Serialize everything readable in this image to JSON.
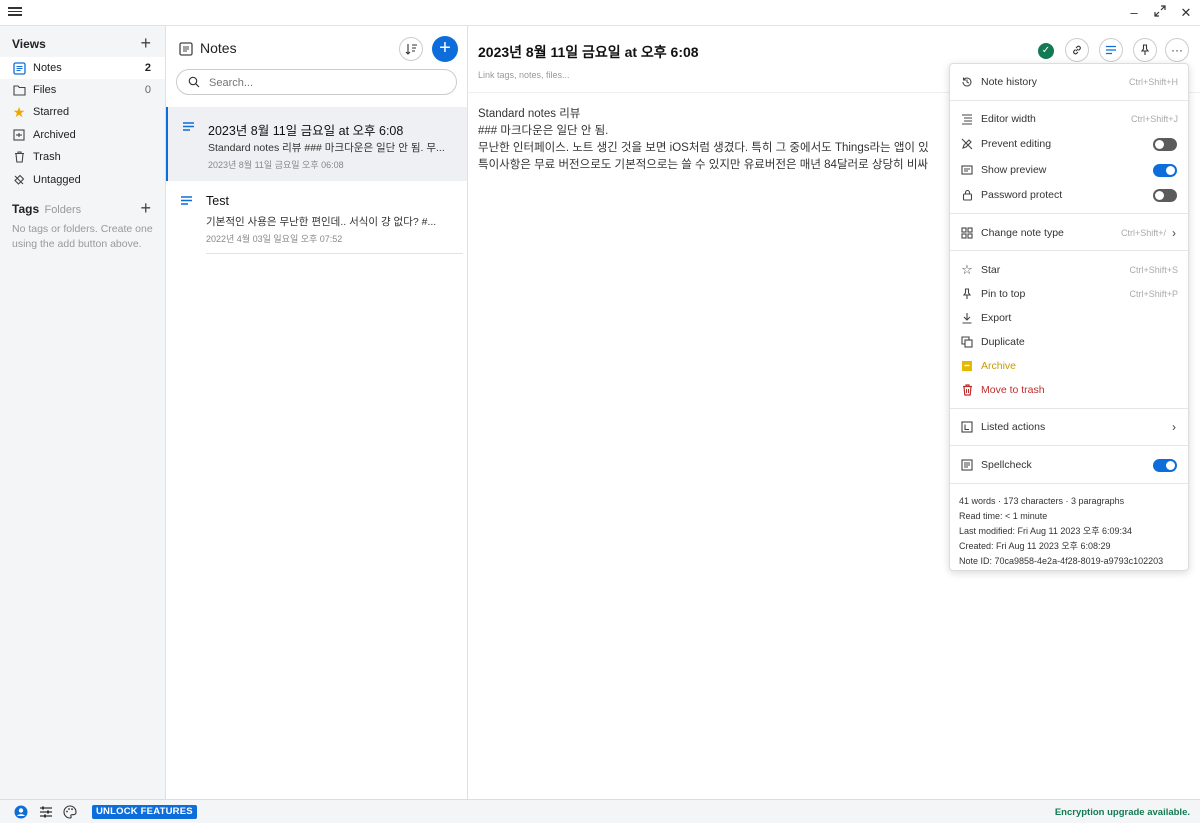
{
  "app": {
    "colors": {
      "accent": "#0c6ddb",
      "success": "#137a53",
      "archive": "#c79a00",
      "trash": "#c02c2c"
    }
  },
  "nav": {
    "views_header": "Views",
    "items": [
      {
        "label": "Notes",
        "count": "2",
        "icon": "notes-icon"
      },
      {
        "label": "Files",
        "count": "0",
        "icon": "folder-icon"
      },
      {
        "label": "Starred",
        "count": "",
        "icon": "star-icon"
      },
      {
        "label": "Archived",
        "count": "",
        "icon": "archive-icon"
      },
      {
        "label": "Trash",
        "count": "",
        "icon": "trash-icon"
      },
      {
        "label": "Untagged",
        "count": "",
        "icon": "untagged-icon"
      }
    ],
    "tags_header": "Tags",
    "tags_sub": "Folders",
    "tags_empty": "No tags or folders. Create one using the add button above."
  },
  "list": {
    "title": "Notes",
    "search_placeholder": "Search...",
    "notes": [
      {
        "title": "2023년 8월 11일 금요일 at 오후 6:08",
        "preview": "Standard notes 리뷰 ### 마크다운은 일단 안 됨. 무...",
        "date": "2023년 8월 11일 금요일 오후 06:08"
      },
      {
        "title": "Test",
        "preview": "기본적인 사용은 무난한 편인데.. 서식이 걍 없다? #...",
        "date": "2022년 4월 03일 일요일 오후 07:52"
      }
    ]
  },
  "editor": {
    "title": "2023년 8월 11일 금요일 at 오후 6:08",
    "tags_placeholder": "Link tags, notes, files...",
    "body": [
      "Standard notes 리뷰",
      "### 마크다운은 일단 안 됨.",
      "무난한 인터페이스. 노트 생긴 것을 보면 iOS처럼 생겼다. 특히 그 중에서도 Things라는 앱이 있",
      "특이사항은 무료 버전으로도 기본적으로는 쓸 수 있지만 유료버전은 매년 84달러로 상당히 비싸"
    ]
  },
  "menu": {
    "note_history": {
      "label": "Note history",
      "shortcut": "Ctrl+Shift+H"
    },
    "editor_width": {
      "label": "Editor width",
      "shortcut": "Ctrl+Shift+J"
    },
    "prevent_editing": {
      "label": "Prevent editing",
      "on": false
    },
    "show_preview": {
      "label": "Show preview",
      "on": true
    },
    "password_protect": {
      "label": "Password protect",
      "on": false
    },
    "change_note_type": {
      "label": "Change note type",
      "shortcut": "Ctrl+Shift+/"
    },
    "star": {
      "label": "Star",
      "shortcut": "Ctrl+Shift+S"
    },
    "pin_to_top": {
      "label": "Pin to top",
      "shortcut": "Ctrl+Shift+P"
    },
    "export": {
      "label": "Export"
    },
    "duplicate": {
      "label": "Duplicate"
    },
    "archive": {
      "label": "Archive"
    },
    "move_to_trash": {
      "label": "Move to trash"
    },
    "listed_actions": {
      "label": "Listed actions"
    },
    "spellcheck": {
      "label": "Spellcheck",
      "on": true
    },
    "info": {
      "stats": "41 words · 173 characters · 3 paragraphs",
      "read_time": "Read time: < 1 minute",
      "last_modified": "Last modified: Fri Aug 11 2023 오후 6:09:34",
      "created": "Created: Fri Aug 11 2023 오후 6:08:29",
      "note_id": "Note ID: 70ca9858-4e2a-4f28-8019-a9793c102203"
    }
  },
  "footer": {
    "unlock_label": "UNLOCK FEATURES",
    "encryption_notice": "Encryption upgrade available."
  }
}
